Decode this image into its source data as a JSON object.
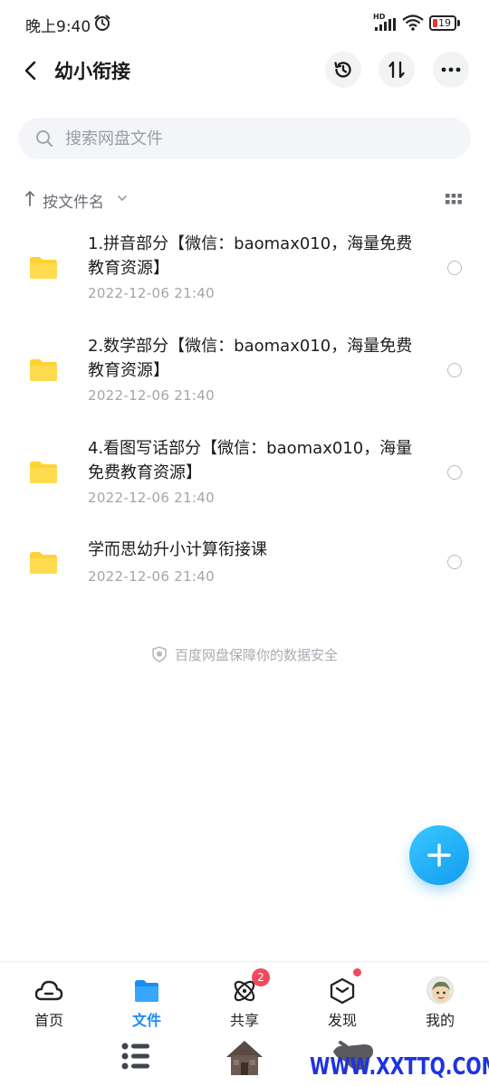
{
  "status_bar": {
    "time": "晚上9:40",
    "network": "HD",
    "battery": "19"
  },
  "header": {
    "title": "幼小衔接"
  },
  "search": {
    "placeholder": "搜索网盘文件"
  },
  "sort": {
    "label": "按文件名"
  },
  "files": [
    {
      "name": "1.拼音部分【微信：baomax010，海量免费教育资源】",
      "date": "2022-12-06  21:40",
      "icon": "folder-icon"
    },
    {
      "name": "2.数学部分【微信：baomax010，海量免费教育资源】",
      "date": "2022-12-06  21:40",
      "icon": "folder-icon"
    },
    {
      "name": "4.看图写话部分【微信：baomax010，海量免费教育资源】",
      "date": "2022-12-06  21:40",
      "icon": "folder-icon"
    },
    {
      "name": "学而思幼升小计算衔接课",
      "date": "2022-12-06  21:40",
      "icon": "folder-icon"
    }
  ],
  "footer_note": "百度网盘保障你的数据安全",
  "bottom_nav": [
    {
      "label": "首页",
      "icon": "home-cloud-icon",
      "active": false
    },
    {
      "label": "文件",
      "icon": "folder-icon",
      "active": true
    },
    {
      "label": "共享",
      "icon": "share-atom-icon",
      "active": false,
      "badge": "2"
    },
    {
      "label": "发现",
      "icon": "discover-box-icon",
      "active": false,
      "dot": true
    },
    {
      "label": "我的",
      "icon": "avatar",
      "active": false
    }
  ],
  "watermark": "WWW.XXTTQ.COM",
  "colors": {
    "accent": "#1a8cf5",
    "folder": "#ffd233",
    "badge": "#f04a5d",
    "fab": "#1fb0f7"
  }
}
